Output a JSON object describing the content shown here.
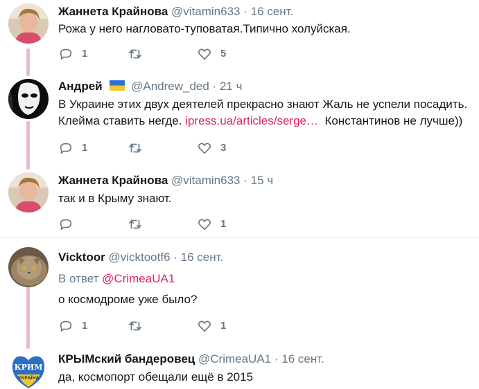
{
  "tweets": [
    {
      "name": "Жаннета Крайнова",
      "handle": "@vitamin633",
      "sep": "·",
      "time": "16 сент.",
      "line1": "Рожа у него нагловато-туповатая.Типично холуйская.",
      "reply_count": "1",
      "retweet_count": "",
      "like_count": "5"
    },
    {
      "name": "Андрей",
      "handle": "@Andrew_ded",
      "sep": "·",
      "time": "21 ч",
      "line1": "В Украине этих двух деятелей прекрасно знают Жаль не успели посадить.",
      "line2_before": "Клейма ставить негде. ",
      "line2_link": "ipress.ua/articles/serge…",
      "line2_after": "  Константинов не лучше))",
      "reply_count": "1",
      "retweet_count": "",
      "like_count": "3"
    },
    {
      "name": "Жаннета Крайнова",
      "handle": "@vitamin633",
      "sep": "·",
      "time": "15 ч",
      "line1": "так и в Крыму знают.",
      "reply_count": "",
      "retweet_count": "",
      "like_count": "1"
    },
    {
      "name": "Vicktoor",
      "handle": "@vicktootf6",
      "sep": "·",
      "time": "16 сент.",
      "reply_prefix": "В ответ ",
      "reply_mention": "@CrimeaUA1",
      "line1": "о космодроме уже было?",
      "reply_count": "1",
      "retweet_count": "",
      "like_count": "1"
    },
    {
      "name": "КРЫМский бандеровец",
      "handle": "@CrimeaUA1",
      "sep": "·",
      "time": "16 сент.",
      "line1": "да, космопорт обещали ещё в 2015",
      "avatar_text_top": "КРИМ",
      "avatar_text_bottom": "УКРАЇНА"
    }
  ],
  "colors": {
    "thread_line": "#e8bcd0",
    "secondary_text": "#657786",
    "link": "#e0245e"
  },
  "icons": [
    "reply-icon",
    "retweet-icon",
    "like-icon",
    "ukraine-flag-icon"
  ]
}
